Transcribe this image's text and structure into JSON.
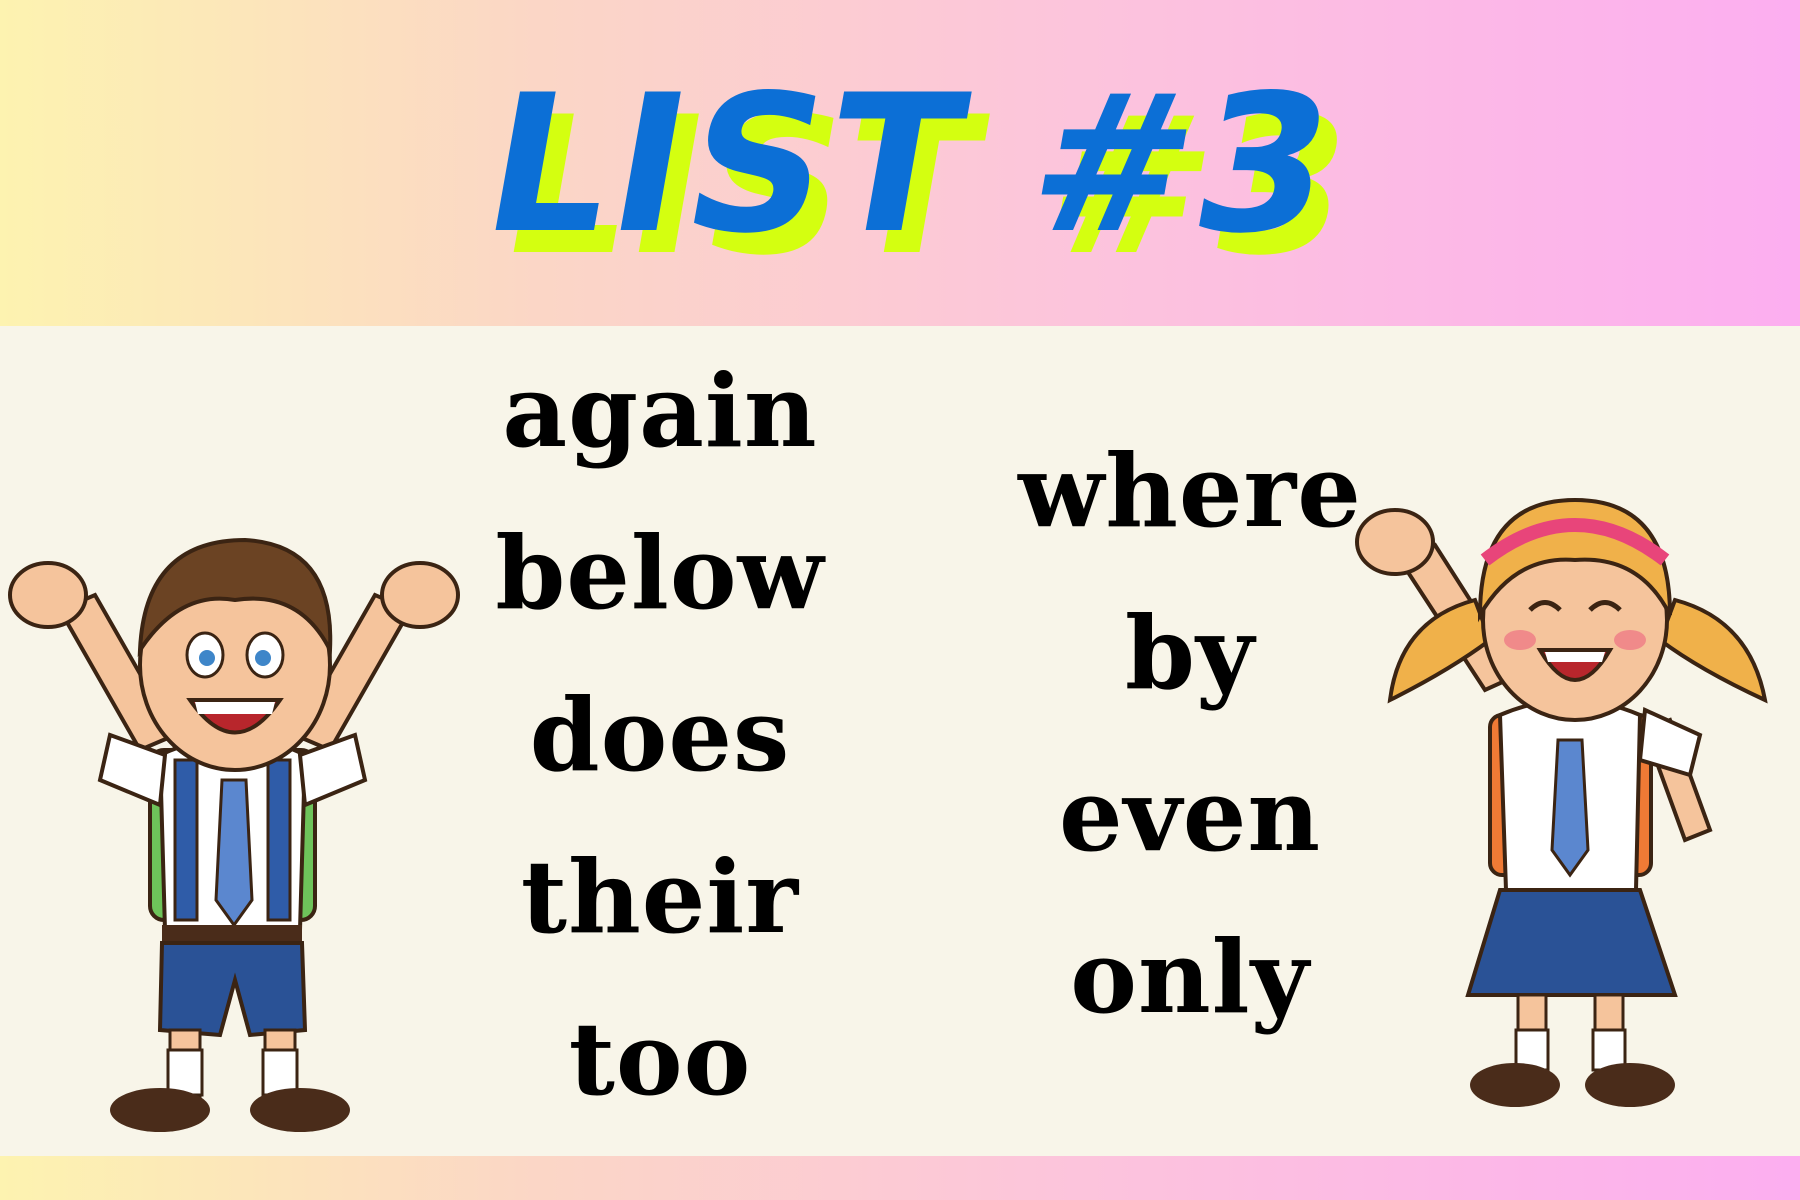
{
  "title": "LIST #3",
  "colors": {
    "title_fill": "#0c6fd6",
    "title_shadow": "#d4ff10",
    "panel": "#f8f5e9",
    "gradient_left": "#fdf3b0",
    "gradient_right": "#fcaef0"
  },
  "words": {
    "left": [
      "again",
      "below",
      "does",
      "their",
      "too"
    ],
    "right": [
      "where",
      "by",
      "even",
      "only"
    ]
  },
  "illustrations": [
    "boy-student-cheering",
    "girl-student-cheering"
  ]
}
